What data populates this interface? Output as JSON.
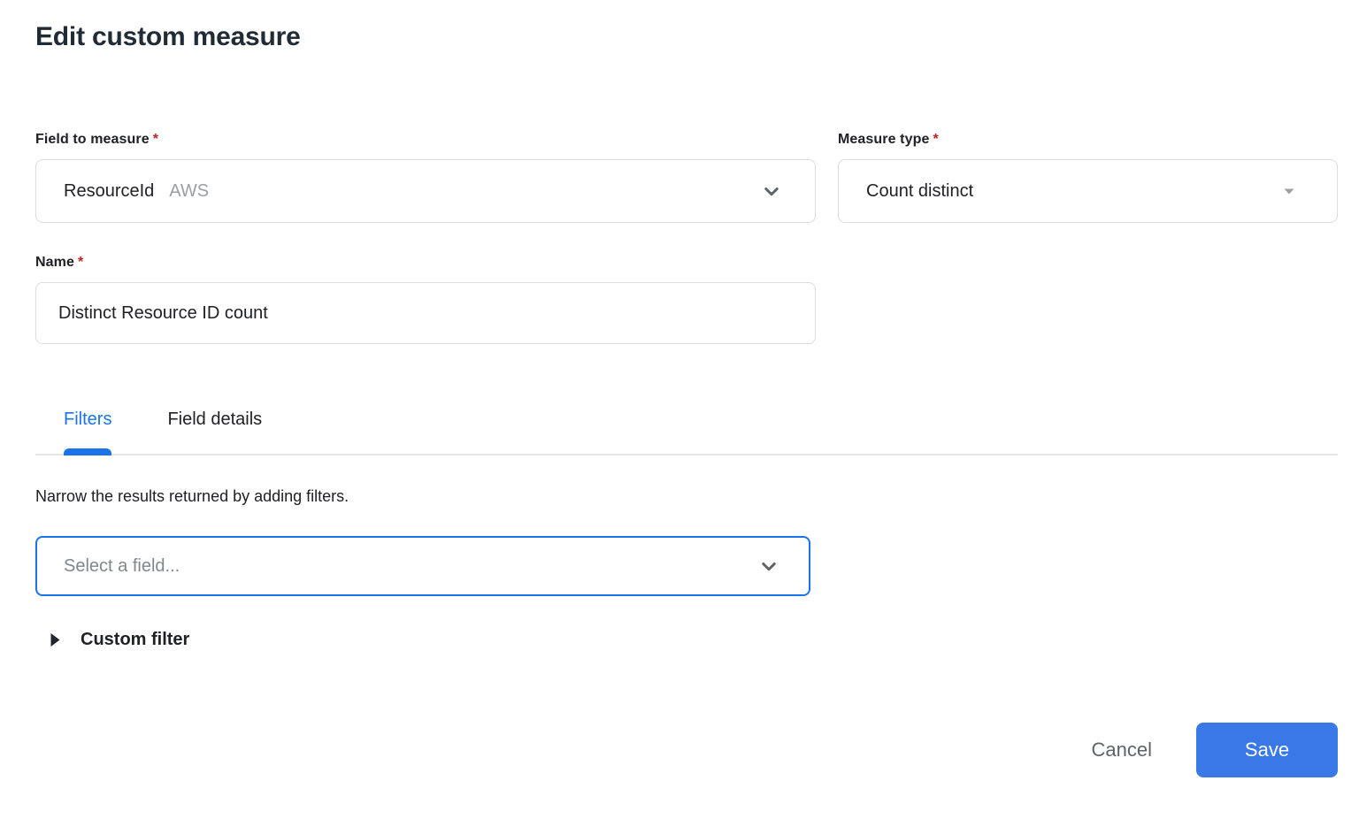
{
  "header": {
    "title": "Edit custom measure"
  },
  "form": {
    "field_to_measure": {
      "label": "Field to measure",
      "required_marker": "*",
      "value": "ResourceId",
      "value_suffix": "AWS",
      "icon": "chevron-down-icon"
    },
    "measure_type": {
      "label": "Measure type",
      "required_marker": "*",
      "value": "Count distinct",
      "icon": "triangle-down-icon"
    },
    "name": {
      "label": "Name",
      "required_marker": "*",
      "value": "Distinct Resource ID count"
    }
  },
  "tabs": [
    {
      "label": "Filters",
      "active": true
    },
    {
      "label": "Field details",
      "active": false
    }
  ],
  "filters": {
    "description": "Narrow the results returned by adding filters.",
    "field_select_placeholder": "Select a field...",
    "field_select_icon": "chevron-down-icon",
    "custom_filter_label": "Custom filter",
    "custom_filter_icon": "triangle-right-icon"
  },
  "footer": {
    "cancel_label": "Cancel",
    "save_label": "Save"
  },
  "colors": {
    "accent_blue": "#1a73e8",
    "save_button_blue": "#3b78e7",
    "required_red": "#c5221f",
    "border_gray": "#dadce0",
    "divider_gray": "#e4e5ea",
    "text_dark": "#202124",
    "title_dark": "#212b36",
    "secondary_gray": "#5f6368",
    "placeholder_gray": "#80868b",
    "suffix_gray": "#9aa0a6"
  }
}
